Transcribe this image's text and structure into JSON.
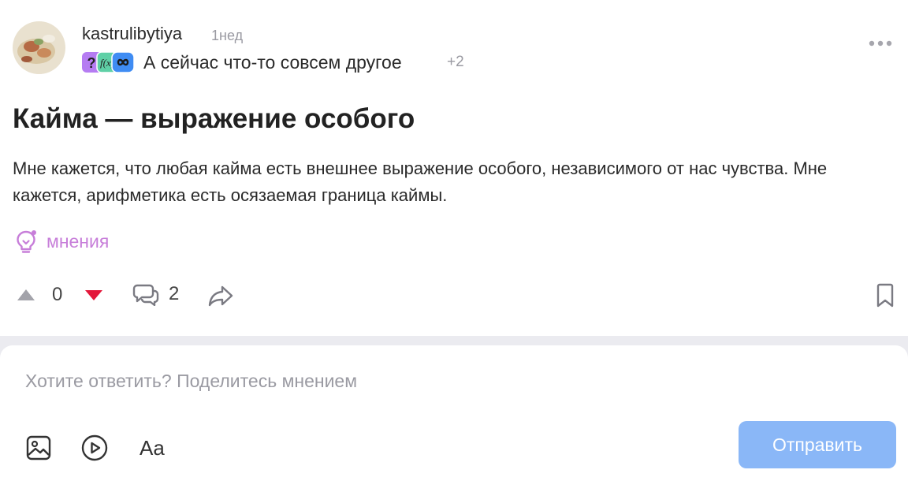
{
  "post": {
    "author": "kastrulibytiya",
    "time": "1нед",
    "community": {
      "name": "А сейчас что-то совсем другое",
      "more": "+2",
      "icons": [
        "question-mark-icon",
        "fx-icon",
        "infinity-icon"
      ]
    },
    "title": "Кайма — выражение особого",
    "body": "Мне кажется, что любая кайма есть внешнее выражение особого, независимого от нас чувства. Мне кажется, арифметика есть осязаемая граница каймы.",
    "opinions_label": "мнения",
    "rating": "0",
    "comments_count": "2"
  },
  "reply": {
    "placeholder": "Хотите ответить? Поделитесь мнением",
    "format_label": "Aa",
    "submit_label": "Отправить"
  },
  "colors": {
    "accent_purple": "#c77ed9",
    "vote_down_red": "#e3173a",
    "submit_blue": "#8ab7f7",
    "muted_gray": "#9a9aa2"
  }
}
